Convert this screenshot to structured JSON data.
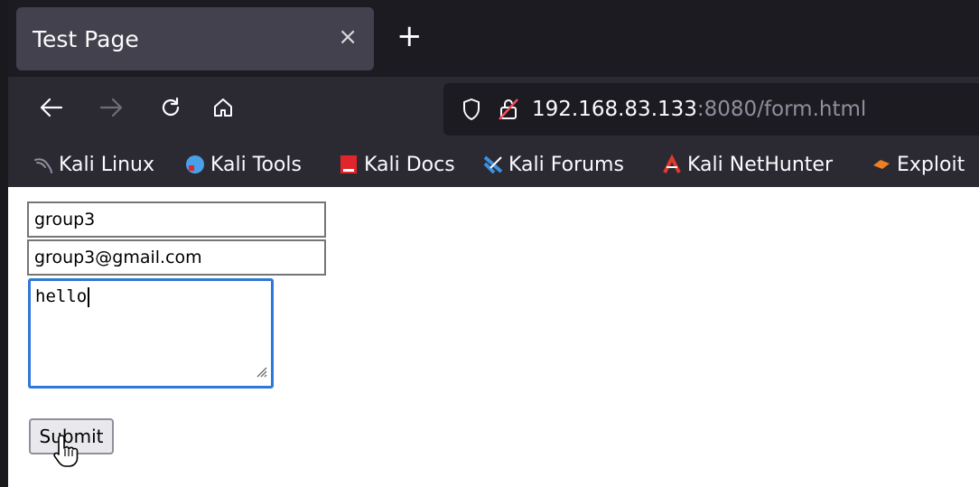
{
  "tab": {
    "title": "Test Page",
    "close_glyph": "×",
    "new_tab_glyph": "+"
  },
  "nav": {
    "back_icon": "back-arrow-icon",
    "forward_icon": "forward-arrow-icon",
    "reload_icon": "reload-icon",
    "home_icon": "home-icon"
  },
  "url": {
    "host": "192.168.83.133",
    "rest": ":8080/form.html"
  },
  "bookmarks": [
    {
      "label": "Kali Linux",
      "icon": "kali-dragon-icon",
      "color": "#8f8f9d"
    },
    {
      "label": "Kali Tools",
      "icon": "kali-tools-icon",
      "color": "#4aa0e8"
    },
    {
      "label": "Kali Docs",
      "icon": "kali-docs-icon",
      "color": "#e0262b"
    },
    {
      "label": "Kali Forums",
      "icon": "kali-forums-icon",
      "color": "#3d8fe0"
    },
    {
      "label": "Kali NetHunter",
      "icon": "kali-nethunter-icon",
      "color": "#e03a2b"
    },
    {
      "label": "Exploit",
      "icon": "exploit-db-icon",
      "color": "#f07f1f"
    }
  ],
  "form": {
    "name_value": "group3",
    "email_value": "group3@gmail.com",
    "message_value": "hello",
    "submit_label": "Submit"
  },
  "colors": {
    "focus_ring": "#2f77d8",
    "chrome_dark": "#1c1b22",
    "chrome": "#2b2a33"
  }
}
